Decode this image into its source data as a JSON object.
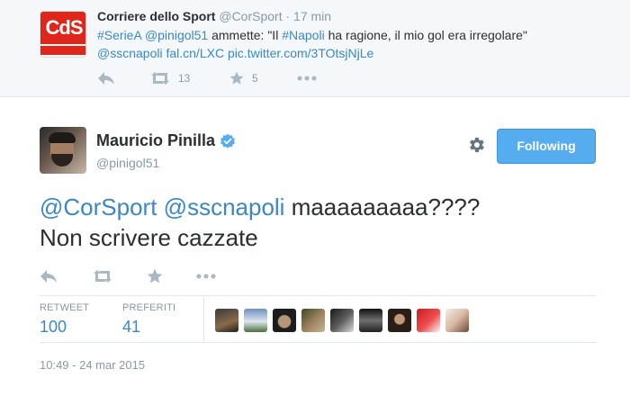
{
  "quoted_tweet": {
    "avatar_text": "CdS",
    "name": "Corriere dello Sport",
    "handle": "@CorSport",
    "separator": "·",
    "time": "17 min",
    "text_parts": [
      {
        "text": "#SerieA",
        "link": true
      },
      {
        "text": " ",
        "link": false
      },
      {
        "text": "@pinigol51",
        "link": true
      },
      {
        "text": " ammette: \"Il ",
        "link": false
      },
      {
        "text": "#Napoli",
        "link": true
      },
      {
        "text": " ha ragione, il mio gol era irregolare\"",
        "link": false
      }
    ],
    "line2_parts": [
      {
        "text": "@sscnapoli",
        "link": true
      },
      {
        "text": " ",
        "link": false
      },
      {
        "text": "fal.cn/LXC",
        "link": true
      },
      {
        "text": " ",
        "link": false
      },
      {
        "text": "pic.twitter.com/3TOtsjNjLe",
        "link": true
      }
    ],
    "actions": {
      "reply_icon": "reply-icon",
      "retweet_icon": "retweet-icon",
      "retweet_count": "13",
      "favorite_icon": "star-icon",
      "favorite_count": "5",
      "more_icon": "more-icon"
    }
  },
  "main_tweet": {
    "name": "Mauricio Pinilla",
    "handle": "@pinigol51",
    "verified_icon": "verified-badge-icon",
    "settings_icon": "gear-icon",
    "follow_label": "Following",
    "text_parts": [
      {
        "text": "@CorSport",
        "link": true
      },
      {
        "text": " ",
        "link": false
      },
      {
        "text": "@sscnapoli",
        "link": true
      },
      {
        "text": " maaaaaaaaa????",
        "link": false
      }
    ],
    "text_line2": "Non scrivere cazzate",
    "stats": {
      "retweet_label": "RETWEET",
      "retweet_value": "100",
      "favorites_label": "PREFERITI",
      "favorites_value": "41"
    },
    "timestamp": "10:49 - 24 mar 2015"
  },
  "colors": {
    "link": "#3b88c3",
    "follow_button": "#55acee",
    "muted": "#8899a6",
    "cds_red": "#e0251b"
  }
}
